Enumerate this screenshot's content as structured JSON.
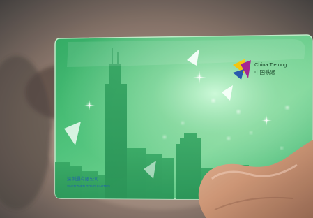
{
  "photo": {
    "subject": "card",
    "colors": {
      "background_dark": "#2b2b2b",
      "background_face": "#b79f8c",
      "card_green": "#39b36a",
      "card_green_light": "#a6e5b4",
      "skyline_green": "#1e8f4e",
      "logo_yellow": "#f2c200",
      "logo_magenta": "#a0198d",
      "logo_blue": "#1b4fa8",
      "finger_skin": "#c58a6a"
    }
  },
  "card": {
    "logo_text_line1": "China Tietong",
    "logo_text_line2": "中国铁通",
    "issuer_line1": "深圳通有限公司",
    "issuer_line2": "SHENZHEN TONG LIMITED"
  }
}
